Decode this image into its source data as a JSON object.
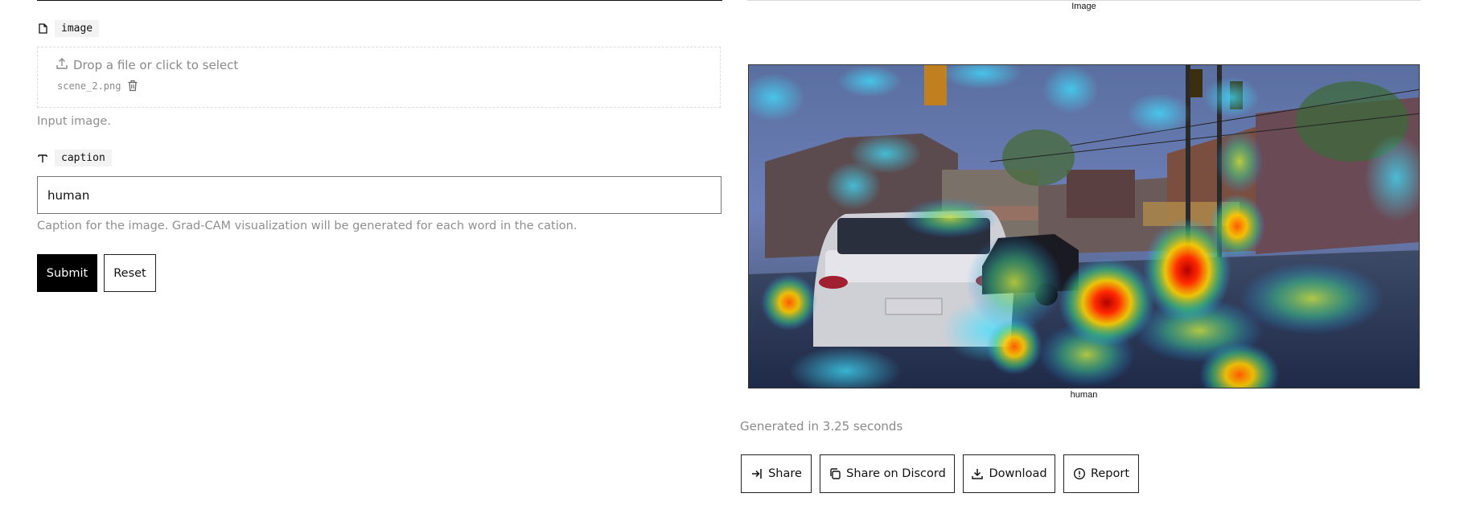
{
  "input_panel": {
    "image_field": {
      "label": "image",
      "icon": "file-icon",
      "drop_text": "Drop a file or click to select",
      "file_name": "scene_2.png",
      "help": "Input image."
    },
    "caption_field": {
      "label": "caption",
      "icon": "text-type-icon",
      "value": "human",
      "help": "Caption for the image. Grad-CAM visualization will be generated for each word in the cation."
    },
    "buttons": {
      "submit": "Submit",
      "reset": "Reset"
    }
  },
  "output_panel": {
    "image_title": "Image",
    "image_caption": "human",
    "generated_text": "Generated in 3.25 seconds",
    "actions": {
      "share": "Share",
      "share_discord": "Share on Discord",
      "download": "Download",
      "report": "Report"
    }
  }
}
